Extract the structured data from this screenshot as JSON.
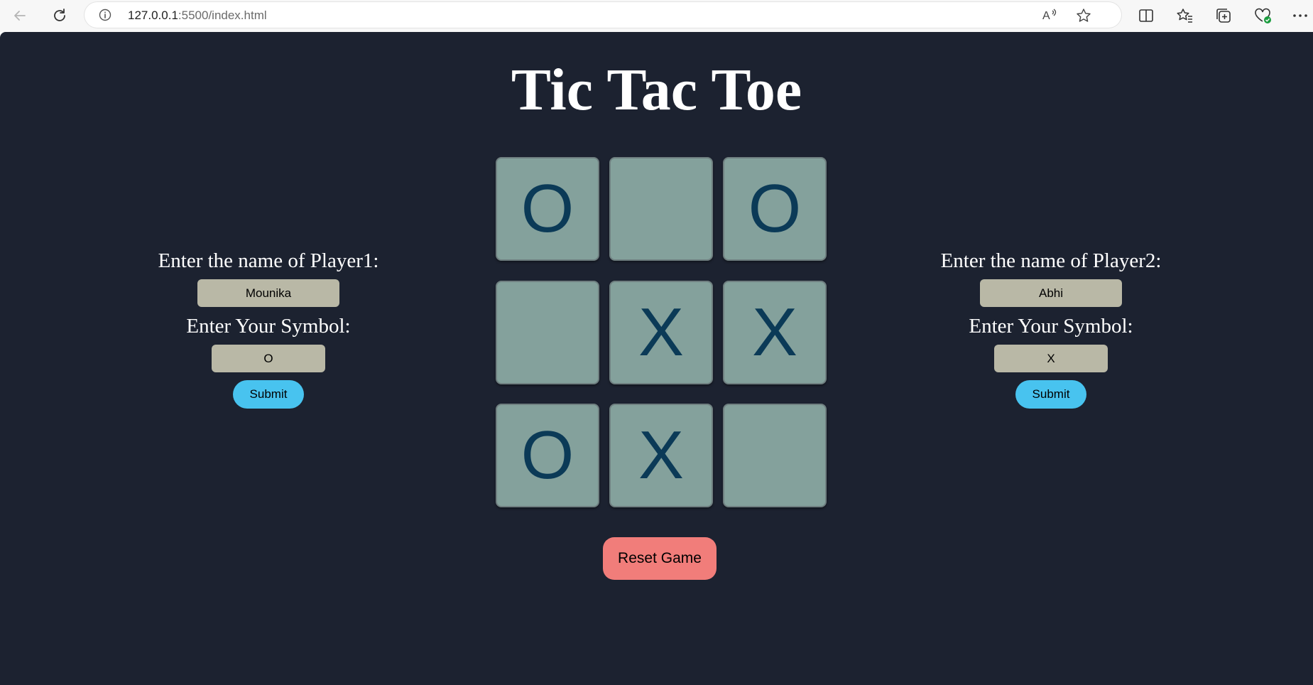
{
  "browser": {
    "url_host": "127.0.0.1",
    "url_rest": ":5500/index.html",
    "icons": [
      "back-icon",
      "refresh-icon",
      "info-icon",
      "read-aloud-icon",
      "favorite-star-icon",
      "split-screen-icon",
      "favorites-icon",
      "collections-icon",
      "browser-essentials-icon",
      "more-icon"
    ]
  },
  "page": {
    "title": "Tic Tac Toe",
    "background": "#1c2230"
  },
  "player1": {
    "name_label": "Enter the name of Player1:",
    "name_value": "Mounika",
    "symbol_label": "Enter Your Symbol:",
    "symbol_value": "O",
    "submit_label": "Submit"
  },
  "player2": {
    "name_label": "Enter the name of Player2:",
    "name_value": "Abhi",
    "symbol_label": "Enter Your Symbol:",
    "symbol_value": "X",
    "submit_label": "Submit"
  },
  "board": {
    "cells": [
      "O",
      "",
      "O",
      "",
      "X",
      "X",
      "O",
      "X",
      ""
    ]
  },
  "reset_label": "Reset Game",
  "colors": {
    "cell": "#84a19c",
    "mark": "#0b3a57",
    "input": "#b9b8a6",
    "submit": "#48c3ef",
    "reset": "#f17d7a"
  }
}
